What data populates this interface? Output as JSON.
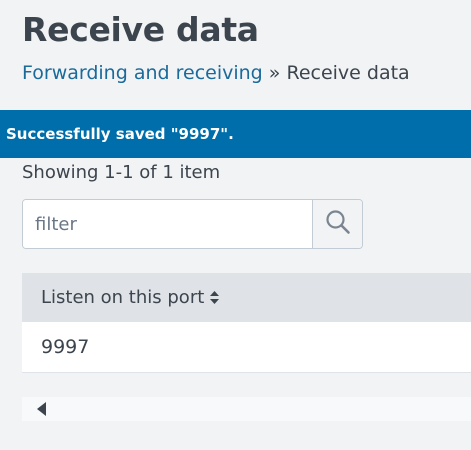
{
  "page": {
    "title": "Receive data"
  },
  "breadcrumb": {
    "parent_label": "Forwarding and receiving",
    "separator": "»",
    "current_label": "Receive data"
  },
  "banner": {
    "message": "Successfully saved \"9997\"."
  },
  "list": {
    "count_text": "Showing 1-1 of 1 item"
  },
  "filter": {
    "placeholder": "filter",
    "value": ""
  },
  "table": {
    "columns": [
      {
        "label": "Listen on this port",
        "sortable": true
      }
    ],
    "rows": [
      {
        "port": "9997"
      }
    ]
  },
  "icons": {
    "search": "search-icon",
    "sort": "sort-icon",
    "scroll_left": "caret-left-icon"
  },
  "colors": {
    "banner_bg": "#006eaa",
    "link": "#1a6a9a",
    "header_bg": "#dfe3e8",
    "page_bg": "#f2f3f5"
  }
}
